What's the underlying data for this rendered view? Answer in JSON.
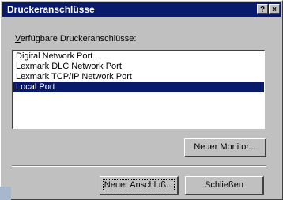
{
  "window": {
    "title": "Druckeranschlüsse",
    "help_glyph": "?",
    "close_glyph": "×"
  },
  "group": {
    "label_accel": "V",
    "label_rest": "erfügbare Druckeranschlüsse:"
  },
  "ports": [
    {
      "label": "Digital Network Port",
      "selected": false
    },
    {
      "label": "Lexmark DLC Network Port",
      "selected": false
    },
    {
      "label": "Lexmark TCP/IP Network Port",
      "selected": false
    },
    {
      "label": "Local Port",
      "selected": true
    }
  ],
  "buttons": {
    "new_monitor": "Neuer Monitor...",
    "new_port": "Neuer Anschluß...",
    "close": "Schließen"
  },
  "colors": {
    "titlebar": "#0a1a6b",
    "selection": "#0a1a6b",
    "face": "#c0c0c0"
  }
}
